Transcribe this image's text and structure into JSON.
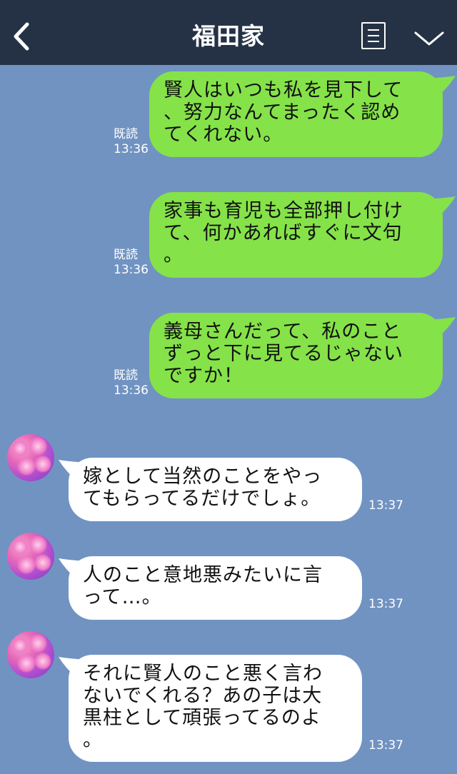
{
  "header": {
    "title": "福田家",
    "back_icon": "chevron-left-icon",
    "menu_icon": "list-icon",
    "dropdown_icon": "chevron-down-icon",
    "background": "#253246"
  },
  "colors": {
    "chat_background": "#7193c2",
    "sent_bubble": "#85e249",
    "received_bubble": "#ffffff"
  },
  "messages": [
    {
      "direction": "sent",
      "lines": [
        "賢人はいつも私を見下して",
        "、努力なんてまったく認め",
        "てくれない。"
      ],
      "read": "既読",
      "time": "13:36"
    },
    {
      "direction": "sent",
      "lines": [
        "家事も育児も全部押し付け",
        "て、何かあればすぐに文句",
        "。"
      ],
      "read": "既読",
      "time": "13:36"
    },
    {
      "direction": "sent",
      "lines": [
        "義母さんだって、私のこと",
        "ずっと下に見てるじゃない",
        "ですか！"
      ],
      "read": "既読",
      "time": "13:36"
    },
    {
      "direction": "received",
      "lines": [
        "嫁として当然のことをやっ",
        "てもらってるだけでしょ。"
      ],
      "time": "13:37"
    },
    {
      "direction": "received",
      "lines": [
        "人のこと意地悪みたいに言",
        "って…。"
      ],
      "time": "13:37"
    },
    {
      "direction": "received",
      "lines": [
        "それに賢人のこと悪く言わ",
        "ないでくれる？あの子は大",
        "黒柱として頑張ってるのよ",
        "。"
      ],
      "time": "13:37"
    }
  ]
}
